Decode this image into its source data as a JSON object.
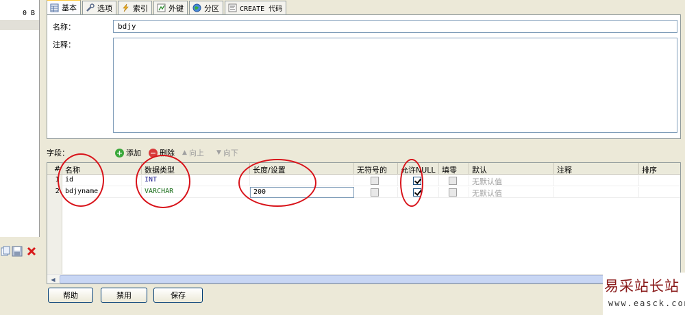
{
  "left_panel": {
    "size_text": "0 B"
  },
  "tabs": [
    {
      "label": "基本",
      "icon": "table-icon",
      "active": true
    },
    {
      "label": "选项",
      "icon": "wrench-icon"
    },
    {
      "label": "索引",
      "icon": "lightning-icon"
    },
    {
      "label": "外键",
      "icon": "chart-icon"
    },
    {
      "label": "分区",
      "icon": "globe-icon"
    },
    {
      "label": "CREATE 代码",
      "icon": "code-icon"
    }
  ],
  "form": {
    "name_label": "名称：",
    "name_value": "bdjy",
    "comment_label": "注释：",
    "comment_value": ""
  },
  "fields_toolbar": {
    "label": "字段：",
    "add": "添加",
    "delete": "删除",
    "up": "向上",
    "down": "向下"
  },
  "grid": {
    "headers": [
      "#",
      "名称",
      "数据类型",
      "长度/设置",
      "无符号的",
      "允许NULL",
      "填零",
      "默认",
      "注释",
      "排序"
    ],
    "rows": [
      {
        "num": "1",
        "name": "id",
        "type": "INT",
        "length": "",
        "unsigned": false,
        "allow_null": true,
        "zerofill": false,
        "default": "无默认值",
        "comment": ""
      },
      {
        "num": "2",
        "name": "bdjyname",
        "type": "VARCHAR",
        "length": "200",
        "unsigned": false,
        "allow_null": true,
        "zerofill": false,
        "default": "无默认值",
        "comment": ""
      }
    ]
  },
  "buttons": {
    "help": "帮助",
    "disable": "禁用",
    "save": "保存"
  },
  "watermark": {
    "title": "易采站长站",
    "url": "www.easck.com"
  },
  "colors": {
    "annotation": "#d8131a",
    "type_int": "#1a1a8c",
    "type_varchar": "#1a6e1a"
  }
}
